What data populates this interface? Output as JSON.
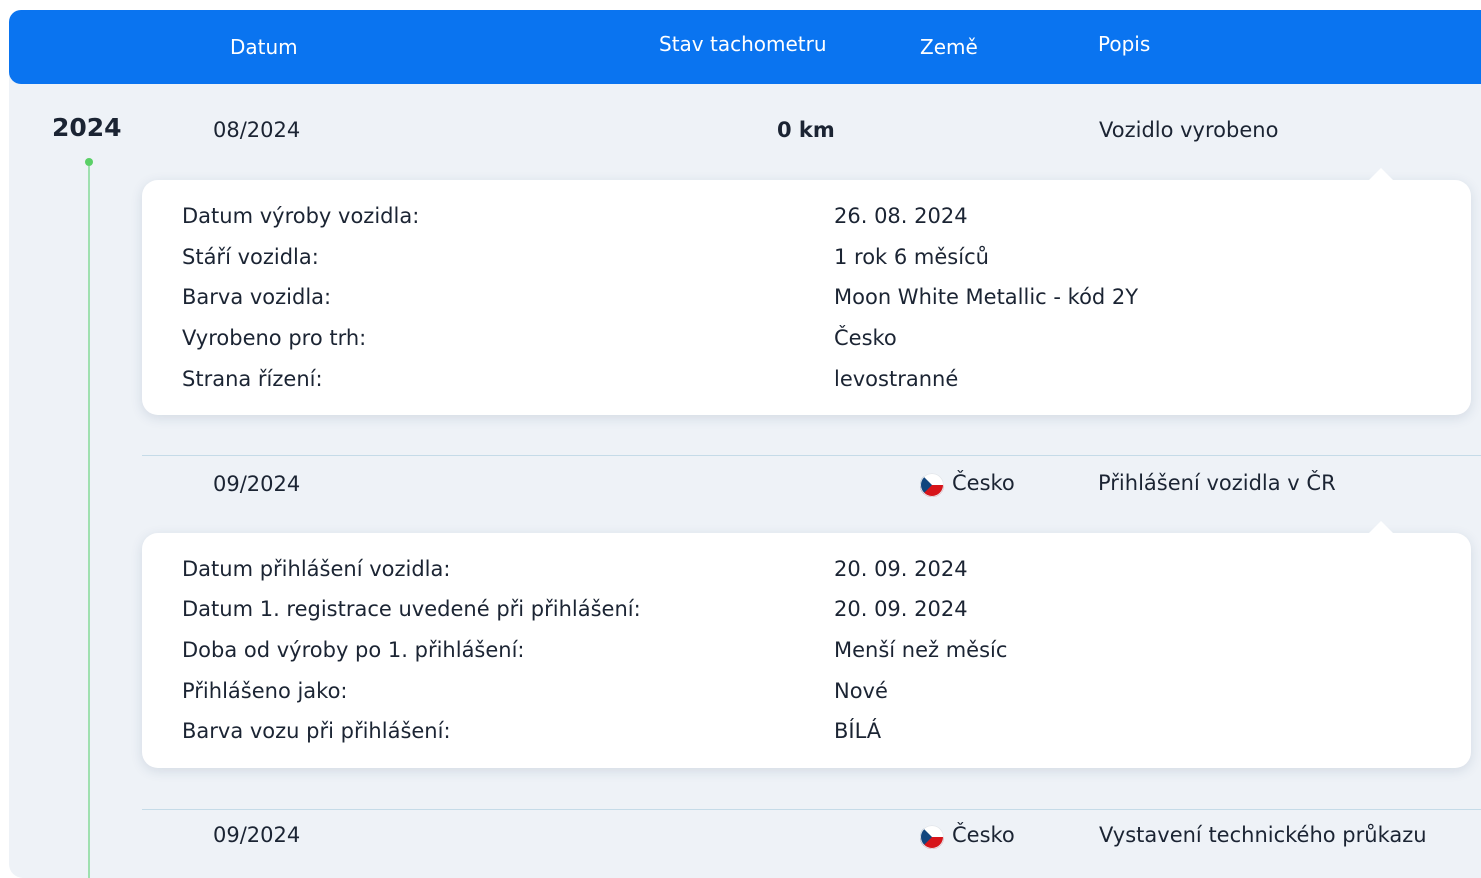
{
  "header": {
    "datum": "Datum",
    "stav": "Stav tachometru",
    "zeme": "Země",
    "popis": "Popis"
  },
  "colors": {
    "header_bg": "#0a74f0",
    "timeline_dot": "#5ad067",
    "panel_bg": "#eef2f7"
  },
  "year": "2024",
  "events": [
    {
      "date": "08/2024",
      "odometer": "0 km",
      "country": "",
      "description": "Vozidlo vyrobeno",
      "details": [
        {
          "label": "Datum výroby vozidla:",
          "value": "26. 08. 2024"
        },
        {
          "label": "Stáří vozidla:",
          "value": "1 rok 6 měsíců"
        },
        {
          "label": "Barva vozidla:",
          "value": "Moon White Metallic - kód 2Y"
        },
        {
          "label": "Vyrobeno pro trh:",
          "value": "Česko"
        },
        {
          "label": "Strana řízení:",
          "value": "levostranné"
        }
      ]
    },
    {
      "date": "09/2024",
      "odometer": "",
      "country": "Česko",
      "country_icon": "czech-flag-icon",
      "description": "Přihlášení vozidla v ČR",
      "details": [
        {
          "label": "Datum přihlášení vozidla:",
          "value": "20. 09. 2024"
        },
        {
          "label": "Datum 1. registrace uvedené při přihlášení:",
          "value": "20. 09. 2024"
        },
        {
          "label": "Doba od výroby po 1. přihlášení:",
          "value": "Menší než měsíc"
        },
        {
          "label": "Přihlášeno jako:",
          "value": "Nové"
        },
        {
          "label": "Barva vozu při přihlášení:",
          "value": "BÍLÁ"
        }
      ]
    },
    {
      "date": "09/2024",
      "odometer": "",
      "country": "Česko",
      "country_icon": "czech-flag-icon",
      "description": "Vystavení technického průkazu"
    }
  ]
}
